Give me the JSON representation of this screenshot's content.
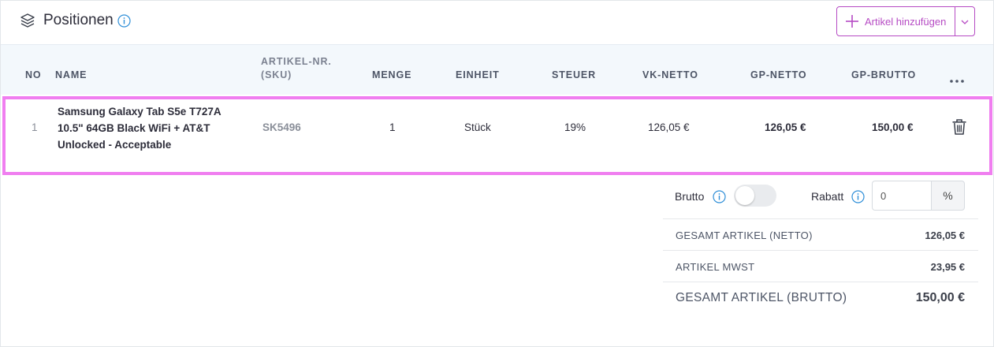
{
  "header": {
    "title": "Positionen",
    "add_button_label": "Artikel hinzufügen",
    "icon": "layers-icon",
    "accent_color": "#b64bc4",
    "info_color": "#2f8fd8"
  },
  "table": {
    "columns": {
      "no": "NO",
      "name": "NAME",
      "sku_line1": "ARTIKEL-NR.",
      "sku_line2": "(SKU)",
      "menge": "MENGE",
      "einheit": "EINHEIT",
      "steuer": "STEUER",
      "vk_netto": "VK-NETTO",
      "gp_netto": "GP-NETTO",
      "gp_brutto": "GP-BRUTTO"
    },
    "rows": [
      {
        "no": "1",
        "name_line1": "Samsung Galaxy Tab S5e T727A",
        "name_line2": "10.5\" 64GB Black WiFi + AT&T",
        "name_line3": "Unlocked - Acceptable",
        "sku": "SK5496",
        "menge": "1",
        "einheit": "Stück",
        "steuer": "19%",
        "vk_netto": "126,05 €",
        "gp_netto": "126,05 €",
        "gp_brutto": "150,00 €"
      }
    ],
    "highlight_color": "#f07ef0"
  },
  "summary": {
    "brutto_label": "Brutto",
    "brutto_enabled": false,
    "rabatt_label": "Rabatt",
    "rabatt_value": "0",
    "rabatt_unit": "%",
    "total_netto_label": "GESAMT ARTIKEL (NETTO)",
    "total_netto_value": "126,05 €",
    "mwst_label": "ARTIKEL MWST",
    "mwst_value": "23,95 €",
    "total_brutto_label": "GESAMT ARTIKEL (BRUTTO)",
    "total_brutto_value": "150,00 €"
  }
}
